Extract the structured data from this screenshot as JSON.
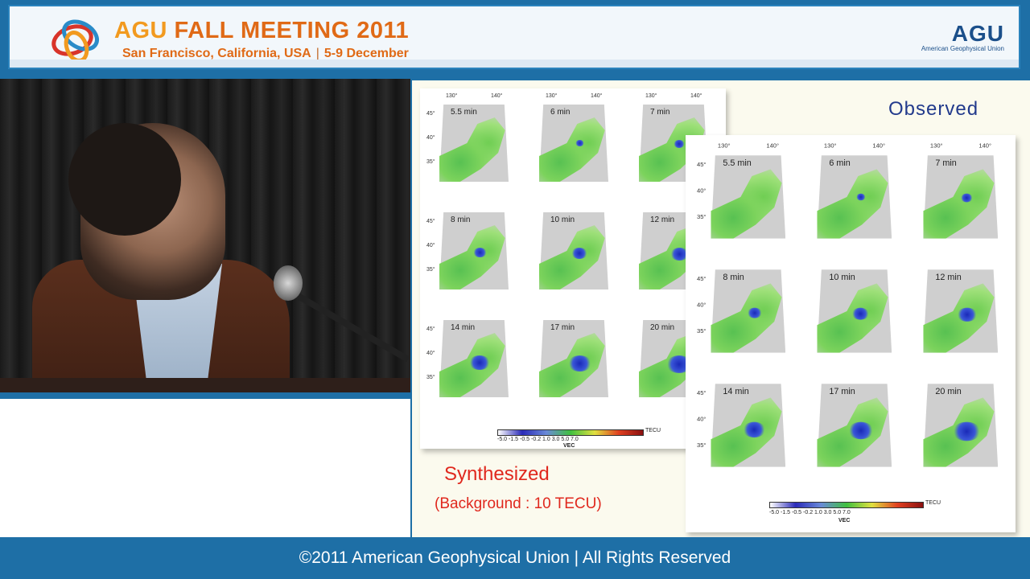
{
  "header": {
    "title_agu": "AGU",
    "title_rest": "FALL MEETING 2011",
    "location": "San Francisco, California, USA",
    "separator": "|",
    "dates": "5-9 December",
    "corner_logo": "AGU",
    "corner_logo_name": "American Geophysical Union"
  },
  "slide": {
    "observed_label": "Observed",
    "synthesized_label": "Synthesized",
    "background_label": "(Background : 10 TECU)",
    "lon_ticks": [
      "130°",
      "140°"
    ],
    "lat_ticks": [
      "45°",
      "40°",
      "35°"
    ],
    "panels": [
      "5.5 min",
      "6 min",
      "7 min",
      "8 min",
      "10 min",
      "12 min",
      "14 min",
      "17 min",
      "20 min"
    ],
    "colorbar_ticks": "-5.0    -1.5    -0.5    -0.2    1.0    3.0    5.0    7.0",
    "colorbar_unit": "TECU",
    "colorbar_label": "VEC"
  },
  "footer": {
    "text": "©2011 American Geophysical Union | All Rights Reserved"
  },
  "colors": {
    "brand_blue": "#1e6fa6",
    "title_orange": "#e06a16",
    "observed_text": "#223a8c",
    "synth_text": "#e0281e"
  }
}
